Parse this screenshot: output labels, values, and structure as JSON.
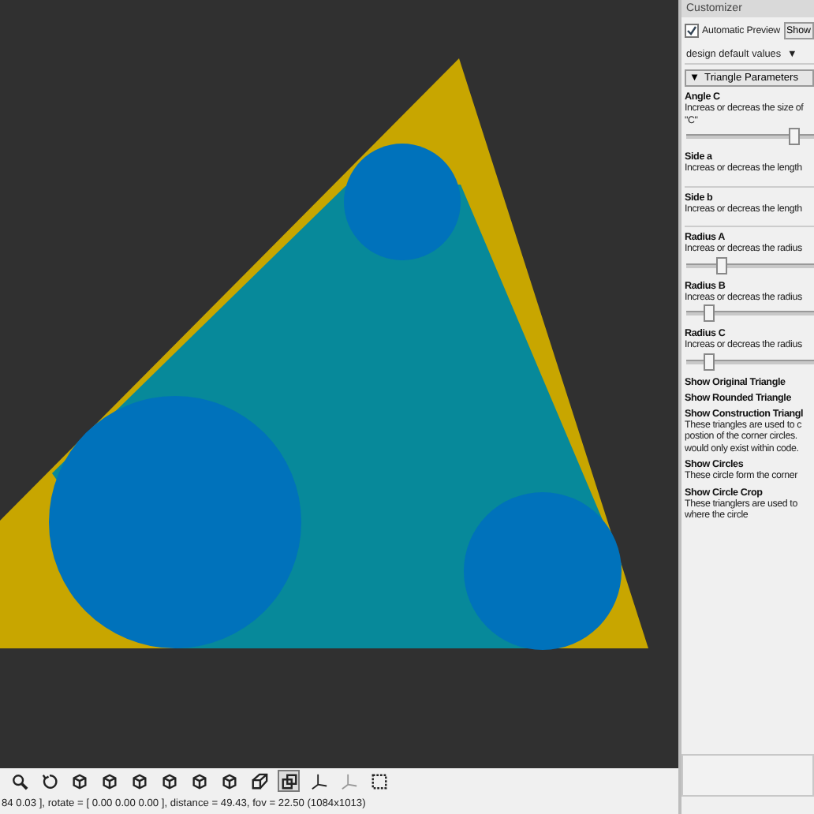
{
  "toolbar": [
    {
      "kind": "zoom",
      "selected": false
    },
    {
      "kind": "reset",
      "selected": false
    },
    {
      "kind": "cube",
      "selected": false
    },
    {
      "kind": "cube",
      "selected": false
    },
    {
      "kind": "cube",
      "selected": false
    },
    {
      "kind": "cube",
      "selected": false
    },
    {
      "kind": "cube",
      "selected": false
    },
    {
      "kind": "cube",
      "selected": false
    },
    {
      "kind": "perspective",
      "selected": false
    },
    {
      "kind": "ortho",
      "selected": true
    },
    {
      "kind": "axes",
      "selected": false
    },
    {
      "kind": "scale",
      "selected": false
    },
    {
      "kind": "frame",
      "selected": false
    }
  ],
  "status_bar": "84 0.03 ], rotate = [ 0.00 0.00 0.00 ], distance = 49.43, fov = 22.50 (1084x1013)",
  "customizer": {
    "title": "Customizer",
    "auto_preview": {
      "label": "Automatic Preview",
      "checked": true
    },
    "show_button": "Show",
    "preset": "design default values",
    "preset_arrow": "▼",
    "section": {
      "arrow": "▼",
      "label": "Triangle Parameters"
    },
    "params": [
      {
        "kind": "slider",
        "name": "Angle C",
        "desc": [
          "Increas or decreas the size of",
          "\"C\""
        ],
        "level": 0.83
      },
      {
        "kind": "field",
        "name": "Side a",
        "desc": [
          "Increas or decreas the length"
        ]
      },
      {
        "kind": "field",
        "name": "Side b",
        "desc": [
          "Increas or decreas the length"
        ]
      },
      {
        "kind": "slider",
        "name": "Radius A",
        "desc": [
          "Increas or decreas the radius"
        ],
        "level": 0.27
      },
      {
        "kind": "slider",
        "name": "Radius B",
        "desc": [
          "Increas or decreas the radius"
        ],
        "level": 0.17
      },
      {
        "kind": "slider",
        "name": "Radius C",
        "desc": [
          "Increas or decreas the radius"
        ],
        "level": 0.17
      },
      {
        "kind": "check",
        "name": "Show Original Triangle"
      },
      {
        "kind": "check",
        "name": "Show Rounded Triangle"
      },
      {
        "kind": "check",
        "name": "Show Construction Triangl",
        "desc": [
          "These triangles are used to c",
          "postion of the corner circles.",
          "would only exist within code."
        ]
      },
      {
        "kind": "check",
        "name": "Show Circles",
        "desc": [
          "These circle form the corner"
        ]
      },
      {
        "kind": "check",
        "name": "Show Circle Crop",
        "desc": [
          "These trianglers are used to",
          "where the circle"
        ]
      }
    ]
  }
}
